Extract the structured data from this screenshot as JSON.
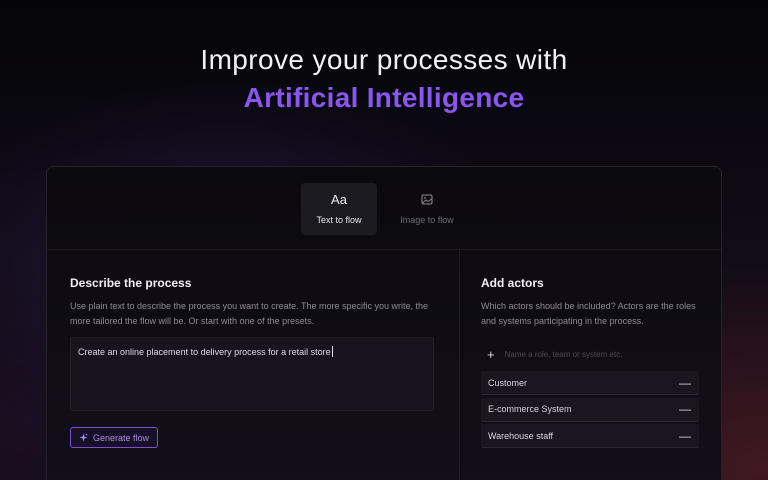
{
  "hero": {
    "line1": "Improve your processes with",
    "line2": "Artificial Intelligence"
  },
  "tabs": [
    {
      "icon_text": "Aa",
      "icon": "text-icon",
      "label": "Text to flow",
      "active": true
    },
    {
      "icon": "image-icon",
      "label": "Image to flow",
      "active": false
    }
  ],
  "process": {
    "title": "Describe the process",
    "description": "Use plain text to describe the process you want to create. The more specific you write, the more tailored the flow will be. Or start with one of the presets.",
    "prompt_value": "Create an online placement to delivery process for a retail store",
    "generate_label": "Generate flow",
    "generate_icon": "sparkle-icon"
  },
  "actors": {
    "title": "Add actors",
    "description": "Which actors should be included? Actors are the roles and systems participating in the process.",
    "input_placeholder": "Name a role, team or system etc.",
    "add_icon": "plus-icon",
    "remove_icon": "minus-icon",
    "items": [
      {
        "name": "Customer"
      },
      {
        "name": "E-commerce System"
      },
      {
        "name": "Warehouse staff"
      }
    ]
  },
  "colors": {
    "accent": "#8a56f0",
    "button_border": "#7a4fd6"
  }
}
